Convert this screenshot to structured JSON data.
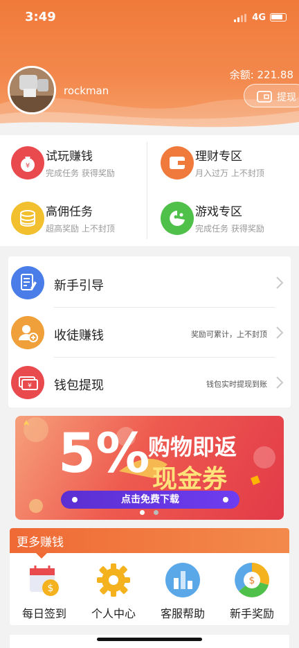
{
  "status_bar": {
    "time": "3:49",
    "network": "4G"
  },
  "profile": {
    "username": "rockman",
    "balance_label": "余额: 221.88",
    "withdraw_label": "提现"
  },
  "grid": [
    {
      "title": "试玩赚钱",
      "subtitle": "完成任务 获得奖励",
      "icon": "money-bag-icon",
      "color": "#e94a4e"
    },
    {
      "title": "理财专区",
      "subtitle": "月入过万 上不封顶",
      "icon": "wallet-icon",
      "color": "#ef7a3c"
    },
    {
      "title": "高佣任务",
      "subtitle": "超高奖励 上不封顶",
      "icon": "coins-icon",
      "color": "#f2c02e"
    },
    {
      "title": "游戏专区",
      "subtitle": "完成任务 获得奖励",
      "icon": "game-icon",
      "color": "#4fc04a"
    }
  ],
  "list": [
    {
      "title": "新手引导",
      "note": "",
      "icon": "guide-document-icon",
      "color": "#4a7de8"
    },
    {
      "title": "收徒赚钱",
      "note": "奖励可累计，上不封顶",
      "icon": "add-user-icon",
      "color": "#f0a03a"
    },
    {
      "title": "钱包提现",
      "note": "钱包实时提现到账",
      "icon": "cash-icon",
      "color": "#e94a4e"
    }
  ],
  "banner": {
    "percent": "5%",
    "line1": "购物即返",
    "line2": "现金券",
    "cta": "点击免费下载"
  },
  "more": {
    "title": "更多赚钱",
    "items": [
      {
        "label": "每日签到",
        "icon": "calendar-coin-icon"
      },
      {
        "label": "个人中心",
        "icon": "gear-icon"
      },
      {
        "label": "客服帮助",
        "icon": "bar-chart-icon"
      },
      {
        "label": "新手奖励",
        "icon": "dollar-pie-icon"
      }
    ]
  },
  "colors": {
    "brand": "#f07a3a",
    "accent_yellow": "#ffe27a",
    "banner_bar": "#6e3df0"
  }
}
